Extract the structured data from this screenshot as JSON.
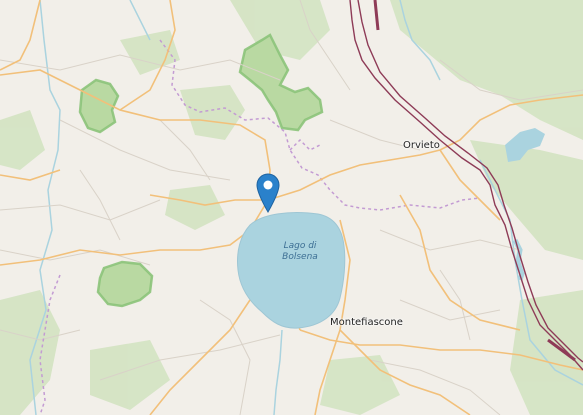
{
  "map": {
    "places": {
      "orvieto": "Orvieto",
      "montefiascone": "Montefiascone"
    },
    "lake": {
      "line1": "Lago di",
      "line2": "Bolsena"
    },
    "marker": {
      "icon": "map-pin-icon",
      "color": "#2a81cb"
    },
    "colors": {
      "land": "#f2efe9",
      "water": "#aad3df",
      "forest": "#c8dfb6",
      "park_border": "#8cc37a",
      "major_road": "#f2c07a",
      "minor_road": "#cfc8bf",
      "admin_border": "#c39bd3",
      "railway": "#8e3b57"
    }
  }
}
